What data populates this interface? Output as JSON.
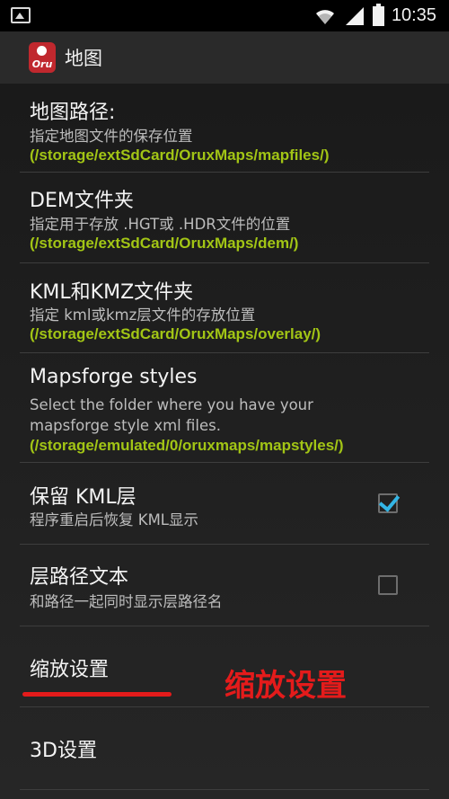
{
  "status_bar": {
    "time": "10:35",
    "icons": [
      "image-icon",
      "wifi-icon",
      "signal-icon",
      "battery-icon"
    ]
  },
  "action_bar": {
    "app_icon_text": "Oru",
    "title": "地图"
  },
  "preferences": [
    {
      "title": "地图路径:",
      "summary": "指定地图文件的保存位置",
      "path": "(/storage/extSdCard/OruxMaps/mapfiles/)"
    },
    {
      "title": "DEM文件夹",
      "summary": "指定用于存放 .HGT或 .HDR文件的位置",
      "path": "(/storage/extSdCard/OruxMaps/dem/)"
    },
    {
      "title": "KML和KMZ文件夹",
      "summary": "指定 kml或kmz层文件的存放位置",
      "path": "(/storage/extSdCard/OruxMaps/overlay/)"
    },
    {
      "title": "Mapsforge styles",
      "summary_line1": "Select the folder where you have your",
      "summary_line2": "mapsforge style xml files.",
      "path": "(/storage/emulated/0/oruxmaps/mapstyles/)"
    },
    {
      "title": "保留 KML层",
      "summary": "程序重启后恢复 KML显示",
      "checked": true
    },
    {
      "title": "层路径文本",
      "summary": "和路径一起同时显示层路径名",
      "checked": false
    },
    {
      "title": "缩放设置"
    },
    {
      "title": "3D设置"
    }
  ],
  "annotation": {
    "text": "缩放设置",
    "color": "#e41b1b"
  },
  "colors": {
    "path_green": "#a2c515",
    "checkbox_accent": "#33b5e5"
  }
}
